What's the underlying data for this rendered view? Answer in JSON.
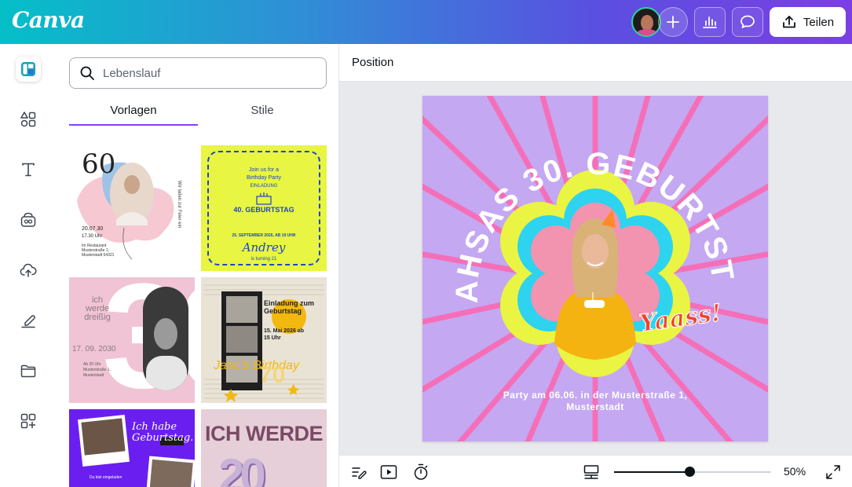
{
  "app": {
    "logo": "Canva"
  },
  "topbar": {
    "share_label": "Teilen"
  },
  "panel": {
    "search_placeholder": "Lebenslauf",
    "tabs": [
      {
        "label": "Vorlagen"
      },
      {
        "label": "Stile"
      }
    ],
    "templates": [
      {
        "number": "60",
        "side_text": "Wir laden zur Feier ein",
        "date": "20.07.30",
        "time": "17.30 Uhr",
        "place": "Im Restaurant Musterstraße 1, Musterstadt 54321"
      },
      {
        "line1": "Join us for a",
        "line2": "Birthday Party",
        "line3": "EINLADUNG",
        "line4": "40. GEBURTSTAG",
        "line5": "25. SEPTEMBER 2026, AB 19 UHR",
        "name": "Andrey",
        "line6": "is turning 21"
      },
      {
        "line1": "ich werde dreißig",
        "date": "17. 09. 2030",
        "number": "30",
        "info": "Ab 20 Uhr Musterstraße 1, Musterstadt"
      },
      {
        "title": "Einladung zum Geburtstag",
        "date": "15. Mai 2026 ab 15 Uhr",
        "script": "Jane's Birthday",
        "number": "70"
      },
      {
        "line1": "Ich habe Geburtstag.",
        "small": "Du bist eingeladen"
      },
      {
        "title": "ICH WERDE",
        "number": "20"
      }
    ]
  },
  "workspace": {
    "position_label": "Position",
    "zoom": "50%",
    "zoom_fraction": 0.48
  },
  "design": {
    "title": "MAHSAS 30. GEBURTSTAG",
    "sticker": "Yaass!",
    "footer": "Party am 06.06. in der Musterstraße 1, Musterstadt",
    "colors": {
      "bg": "#c4a8f2",
      "rays": "#f56fb8",
      "flower_outer": "#e9f542",
      "flower_mid": "#2ed3f0",
      "flower_inner": "#f293b0"
    }
  }
}
